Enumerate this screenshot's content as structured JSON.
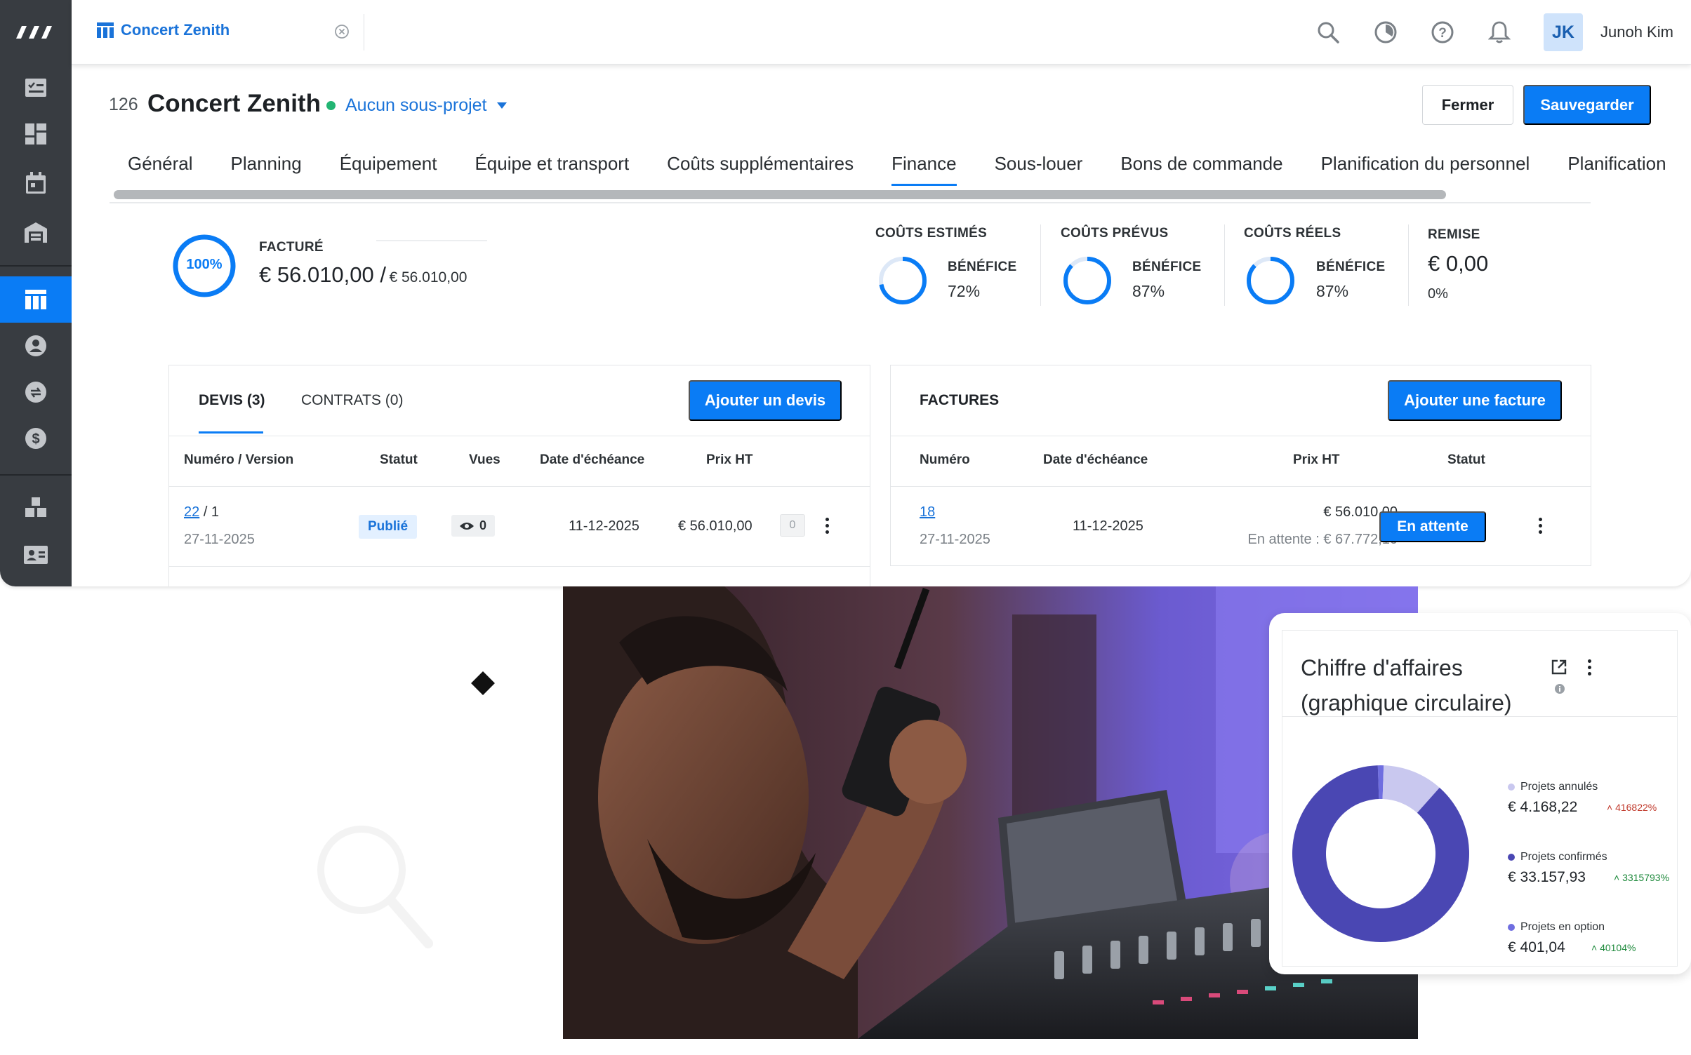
{
  "topbar": {
    "tab_title": "Concert Zenith",
    "user_initials": "JK",
    "user_name": "Junoh Kim"
  },
  "header": {
    "project_number": "126",
    "project_title": "Concert Zenith",
    "subproject": "Aucun sous-projet",
    "close_label": "Fermer",
    "save_label": "Sauvegarder"
  },
  "tabs": [
    "Général",
    "Planning",
    "Équipement",
    "Équipe et transport",
    "Coûts supplémentaires",
    "Finance",
    "Sous-louer",
    "Bons de commande",
    "Planification du personnel",
    "Planification"
  ],
  "active_tab": "Finance",
  "summary": {
    "invoiced_pct": "100%",
    "invoiced_label": "FACTURÉ",
    "invoiced_amount": "€ 56.010,00 /",
    "invoiced_total": "€ 56.010,00",
    "estimated": {
      "label": "COÛTS ESTIMÉS",
      "benefit_label": "BÉNÉFICE",
      "benefit": "72%",
      "progress": 0.72
    },
    "planned": {
      "label": "COÛTS PRÉVUS",
      "benefit_label": "BÉNÉFICE",
      "benefit": "87%",
      "progress": 0.87
    },
    "actual": {
      "label": "COÛTS RÉELS",
      "benefit_label": "BÉNÉFICE",
      "benefit": "87%",
      "progress": 0.87
    },
    "discount": {
      "label": "REMISE",
      "amount": "€ 0,00",
      "pct": "0%"
    }
  },
  "quotes_card": {
    "tab_quotes": "DEVIS (3)",
    "tab_contracts": "CONTRATS (0)",
    "add_button": "Ajouter un devis",
    "columns": [
      "Numéro / Version",
      "Statut",
      "Vues",
      "Date d'échéance",
      "Prix HT"
    ],
    "row": {
      "number": "22",
      "version": "/ 1",
      "created": "27-11-2025",
      "status": "Publié",
      "views": "0",
      "due": "11-12-2025",
      "price": "€ 56.010,00",
      "chip": "0"
    }
  },
  "invoices_card": {
    "title": "FACTURES",
    "add_button": "Ajouter une facture",
    "columns": [
      "Numéro",
      "Date d'échéance",
      "Prix HT",
      "Statut"
    ],
    "row": {
      "number": "18",
      "created": "27-11-2025",
      "due": "11-12-2025",
      "price": "€ 56.010,00",
      "pending": "En attente : € 67.772,10",
      "status": "En attente"
    }
  },
  "widget": {
    "title": "Chiffre d'affaires (graphique circulaire)",
    "legend": [
      {
        "name": "Projets annulés",
        "value": "€ 4.168,22",
        "delta": "416822%",
        "color": "#c9c8ef",
        "delta_color": "#c0392b"
      },
      {
        "name": "Projets confirmés",
        "value": "€ 33.157,93",
        "delta": "3315793%",
        "color": "#4a47b3",
        "delta_color": "#1e8a3c"
      },
      {
        "name": "Projets en option",
        "value": "€ 401,04",
        "delta": "40104%",
        "color": "#6f6ee0",
        "delta_color": "#1e8a3c"
      }
    ]
  },
  "chart_data": {
    "type": "pie",
    "title": "Chiffre d'affaires (graphique circulaire)",
    "categories": [
      "Projets annulés",
      "Projets confirmés",
      "Projets en option"
    ],
    "values": [
      4168.22,
      33157.93,
      401.04
    ],
    "colors": [
      "#c9c8ef",
      "#4a47b3",
      "#6f6ee0"
    ],
    "legend": "right"
  }
}
